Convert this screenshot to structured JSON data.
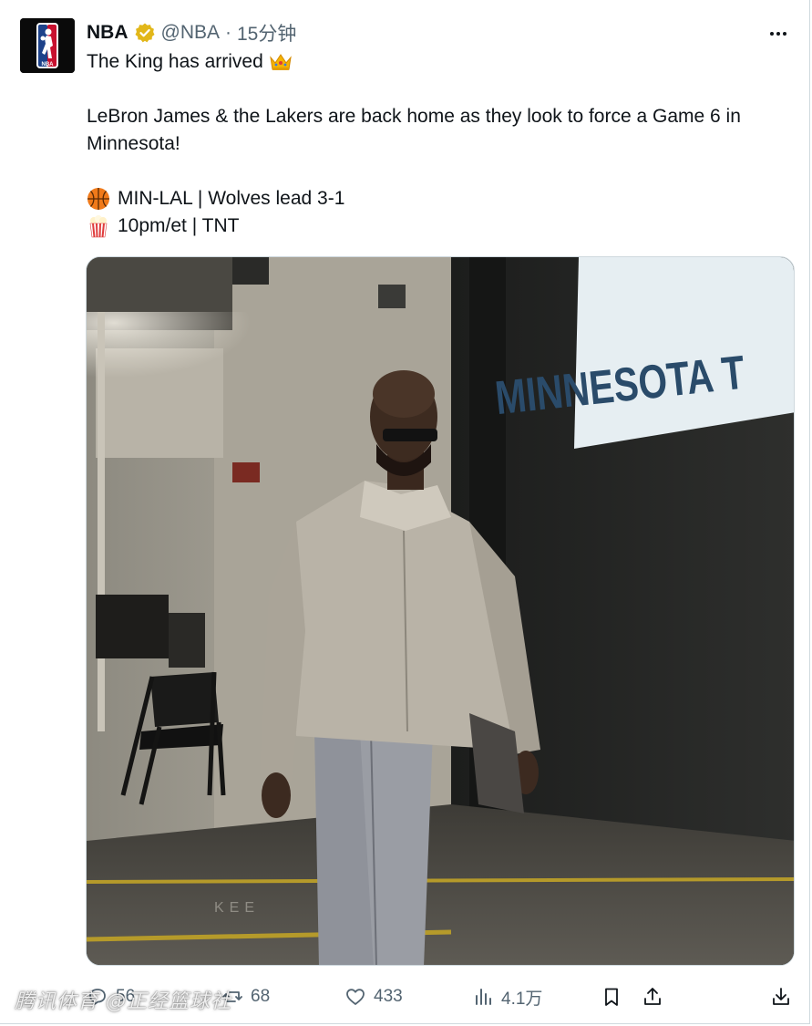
{
  "author": {
    "name": "NBA",
    "handle": "@NBA",
    "separator": "·",
    "time": "15分钟",
    "verified": true,
    "avatar_icon": "nba-logo-icon",
    "avatar_text": "NBA"
  },
  "tweet": {
    "line1": "The King has arrived",
    "line2": "LeBron James & the Lakers are back home as they look to force a Game 6 in",
    "line3": "Minnesota!",
    "line4": "MIN-LAL | Wolves lead 3-1",
    "line5": "10pm/et | TNT",
    "emojis": [
      "crown-icon",
      "basketball-icon",
      "popcorn-icon"
    ]
  },
  "media": {
    "type": "video",
    "sign_text": "MINNESOTA T",
    "floor_text": "KEE"
  },
  "actions": {
    "replies": "56",
    "reposts": "68",
    "likes": "433",
    "views": "4.1万"
  },
  "watermark": "腾讯体育 @正经篮球社",
  "colors": {
    "text": "#0f1419",
    "secondary": "#536471",
    "verified_badge": "#e2b719",
    "border": "#cfd9de"
  }
}
